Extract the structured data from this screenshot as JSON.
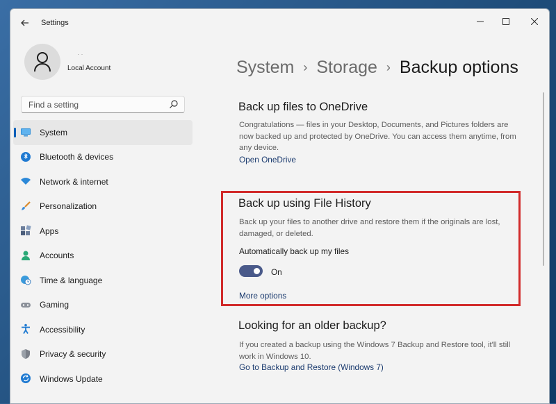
{
  "window": {
    "title": "Settings"
  },
  "profile": {
    "name": "Local Account",
    "secondary": "· ·"
  },
  "search": {
    "placeholder": "Find a setting"
  },
  "nav": {
    "items": [
      {
        "label": "System",
        "icon": "system-icon"
      },
      {
        "label": "Bluetooth & devices",
        "icon": "bluetooth-icon"
      },
      {
        "label": "Network & internet",
        "icon": "wifi-icon"
      },
      {
        "label": "Personalization",
        "icon": "brush-icon"
      },
      {
        "label": "Apps",
        "icon": "apps-icon"
      },
      {
        "label": "Accounts",
        "icon": "person-icon"
      },
      {
        "label": "Time & language",
        "icon": "globe-clock-icon"
      },
      {
        "label": "Gaming",
        "icon": "gamepad-icon"
      },
      {
        "label": "Accessibility",
        "icon": "accessibility-icon"
      },
      {
        "label": "Privacy & security",
        "icon": "shield-icon"
      },
      {
        "label": "Windows Update",
        "icon": "update-icon"
      }
    ]
  },
  "breadcrumb": {
    "items": [
      "System",
      "Storage",
      "Backup options"
    ]
  },
  "onedrive": {
    "title": "Back up files to OneDrive",
    "desc": "Congratulations — files in your Desktop, Documents, and Pictures folders are now backed up and protected by OneDrive. You can access them anytime, from any device.",
    "link": "Open OneDrive"
  },
  "file_history": {
    "title": "Back up using File History",
    "desc": "Back up your files to another drive and restore them if the originals are lost, damaged, or deleted.",
    "auto_label": "Automatically back up my files",
    "toggle_state": "On",
    "more_options": "More options"
  },
  "older": {
    "title": "Looking for an older backup?",
    "desc": "If you created a backup using the Windows 7 Backup and Restore tool, it'll still work in Windows 10.",
    "link": "Go to Backup and Restore (Windows 7)"
  },
  "colors": {
    "accent": "#005fb8",
    "highlight": "#d12a2a",
    "toggle": "#4a5a8a"
  }
}
